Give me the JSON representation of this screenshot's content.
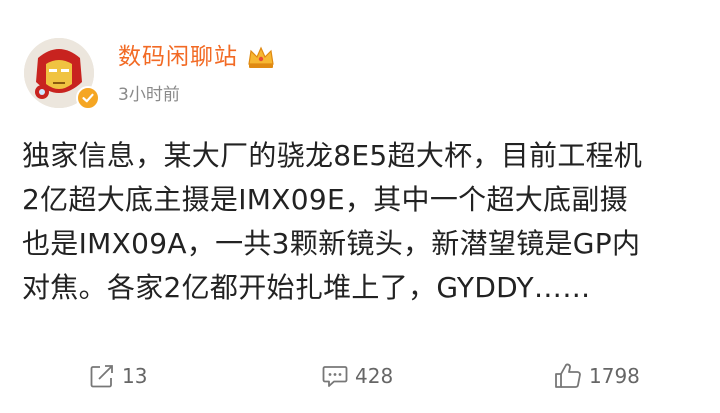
{
  "post": {
    "author": {
      "name": "数码闲聊站",
      "time": "3小时前"
    },
    "content_lines": [
      "独家信息，某大厂的骁龙8E5超大杯，目前工程机",
      "2亿超大底主摄是IMX09E，其中一个超大底副摄",
      "也是IMX09A，一共3颗新镜头，新潜望镜是GP内",
      "对焦。各家2亿都开始扎堆上了，GYDDY……"
    ],
    "actions": {
      "repost": {
        "count": "13",
        "icon": "repost-icon"
      },
      "comment": {
        "count": "428",
        "icon": "comment-icon"
      },
      "like": {
        "count": "1798",
        "icon": "thumbs-up-icon"
      }
    }
  },
  "colors": {
    "username": "#f26a24",
    "body_text": "#222222",
    "meta_text": "#8a8a8a",
    "action_text": "#666666",
    "verified_badge": "#f5a623"
  }
}
